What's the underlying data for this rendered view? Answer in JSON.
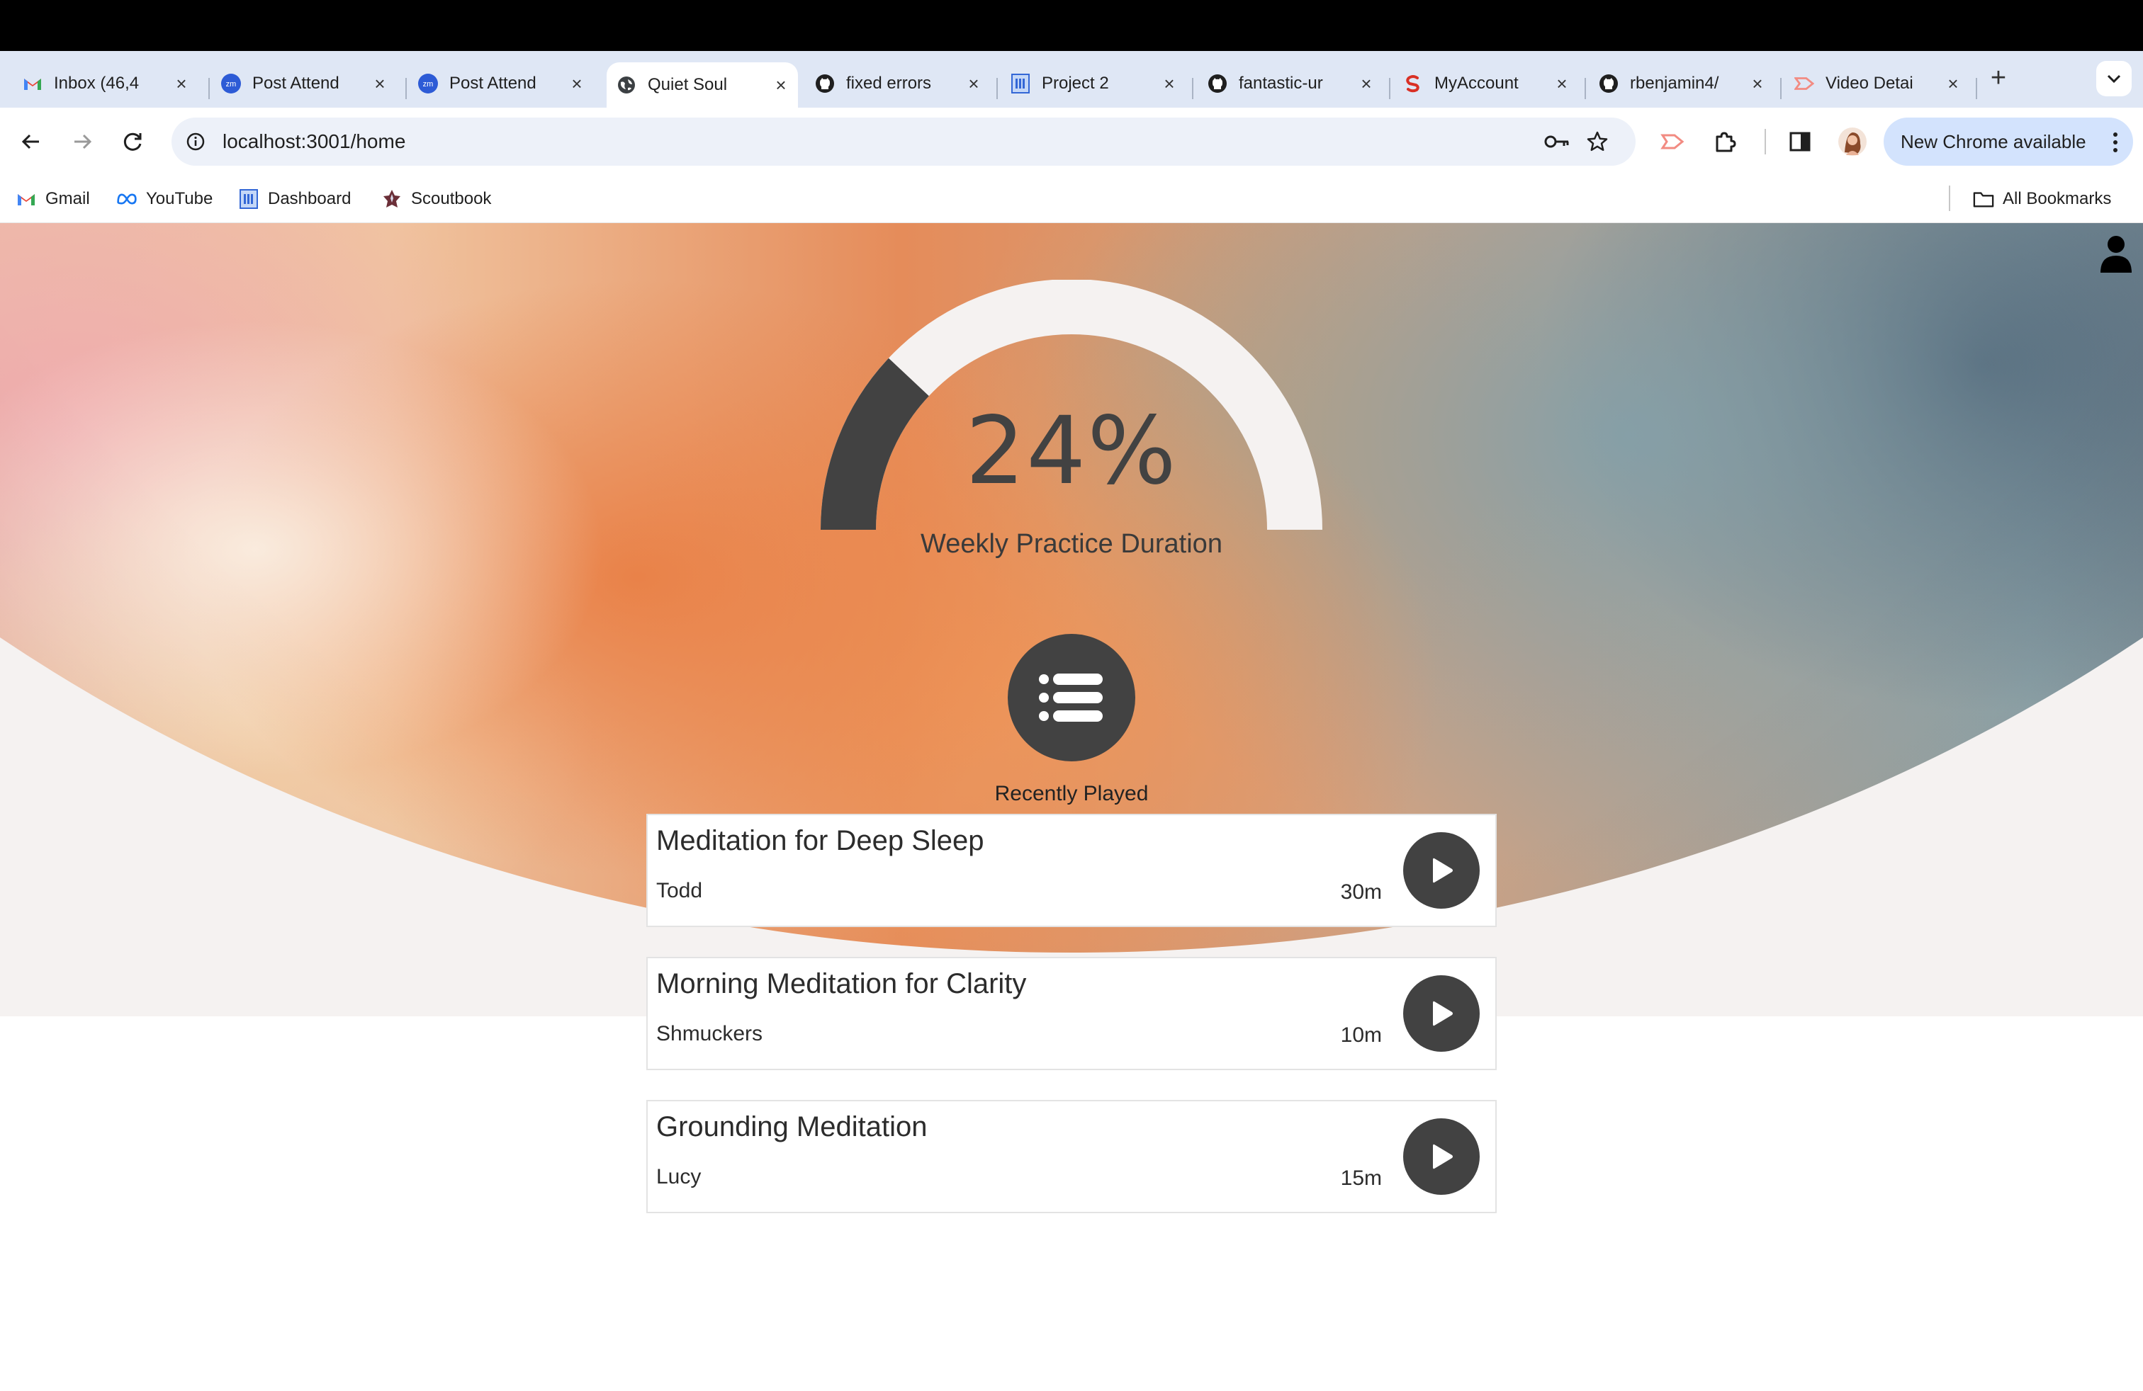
{
  "browser": {
    "tabs": [
      {
        "title": "Inbox (46,4",
        "icon": "gmail-icon",
        "active": false
      },
      {
        "title": "Post Attend",
        "icon": "zoom-icon",
        "active": false
      },
      {
        "title": "Post Attend",
        "icon": "zoom-icon",
        "active": false
      },
      {
        "title": "Quiet Soul",
        "icon": "globe-icon",
        "active": true
      },
      {
        "title": "fixed errors",
        "icon": "github-icon",
        "active": false
      },
      {
        "title": "Project 2",
        "icon": "document-icon",
        "active": false
      },
      {
        "title": "fantastic-ur",
        "icon": "github-icon",
        "active": false
      },
      {
        "title": "MyAccount",
        "icon": "myaccount-icon",
        "active": false
      },
      {
        "title": "rbenjamin4/",
        "icon": "github-icon",
        "active": false
      },
      {
        "title": "Video Detai",
        "icon": "video-icon",
        "active": false
      }
    ],
    "close_glyph": "×",
    "new_tab_glyph": "+",
    "url": "localhost:3001/home",
    "update_label": "New Chrome available",
    "bookmarks": [
      {
        "label": "Gmail",
        "icon": "gmail-icon"
      },
      {
        "label": "YouTube",
        "icon": "meta-icon"
      },
      {
        "label": "Dashboard",
        "icon": "document-icon"
      },
      {
        "label": "Scoutbook",
        "icon": "scout-icon"
      }
    ],
    "all_bookmarks_label": "All Bookmarks"
  },
  "app": {
    "progress": {
      "value_text": "24%",
      "fraction": 0.24,
      "label": "Weekly Practice Duration"
    },
    "recently_played_title": "Recently Played",
    "recent": [
      {
        "title": "Meditation for Deep Sleep",
        "author": "Todd",
        "duration": "30m"
      },
      {
        "title": "Morning Meditation for Clarity",
        "author": "Shmuckers",
        "duration": "10m"
      },
      {
        "title": "Grounding Meditation",
        "author": "Lucy",
        "duration": "15m"
      }
    ],
    "colors": {
      "accent_dark": "#424242",
      "gauge_track": "#f5f2f1",
      "page_gray": "#f5f2f1"
    }
  }
}
